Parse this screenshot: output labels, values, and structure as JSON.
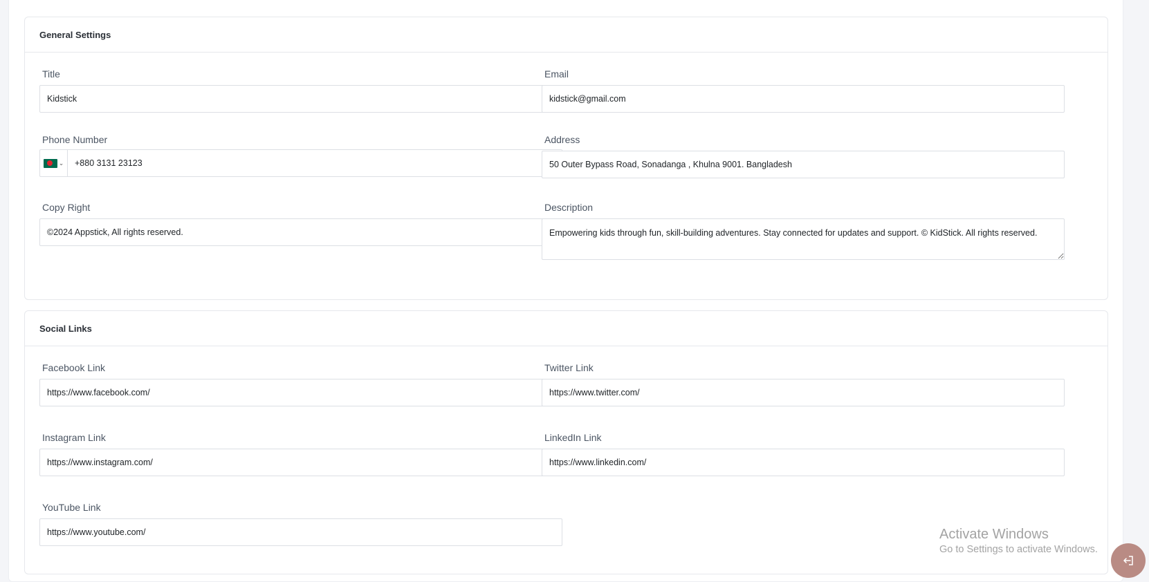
{
  "general": {
    "title": "General Settings",
    "fields": {
      "title": {
        "label": "Title",
        "value": "Kidstick"
      },
      "email": {
        "label": "Email",
        "value": "kidstick@gmail.com"
      },
      "phone": {
        "label": "Phone Number",
        "value": "+880 3131 23123",
        "country_flag": "bd-flag-icon"
      },
      "address": {
        "label": "Address",
        "value": "50 Outer Bypass Road, Sonadanga , Khulna 9001. Bangladesh"
      },
      "copyright": {
        "label": "Copy Right",
        "value": "©2024 Appstick, All rights reserved."
      },
      "description": {
        "label": "Description",
        "value": "Empowering kids through fun, skill-building adventures. Stay connected for updates and support. © KidStick. All rights reserved."
      }
    }
  },
  "social": {
    "title": "Social Links",
    "fields": {
      "facebook": {
        "label": "Facebook Link",
        "value": "https://www.facebook.com/"
      },
      "twitter": {
        "label": "Twitter Link",
        "value": "https://www.twitter.com/"
      },
      "instagram": {
        "label": "Instagram Link",
        "value": "https://www.instagram.com/"
      },
      "linkedin": {
        "label": "LinkedIn Link",
        "value": "https://www.linkedin.com/"
      },
      "youtube": {
        "label": "YouTube Link",
        "value": "https://www.youtube.com/"
      }
    }
  },
  "watermark": {
    "title": "Activate Windows",
    "subtitle": "Go to Settings to activate Windows."
  },
  "fab": {
    "icon": "logout-icon"
  },
  "colors": {
    "fab": "#b98b84",
    "border": "#dcdfe4",
    "bd_green": "#006a4e",
    "bd_red": "#e0242e"
  }
}
